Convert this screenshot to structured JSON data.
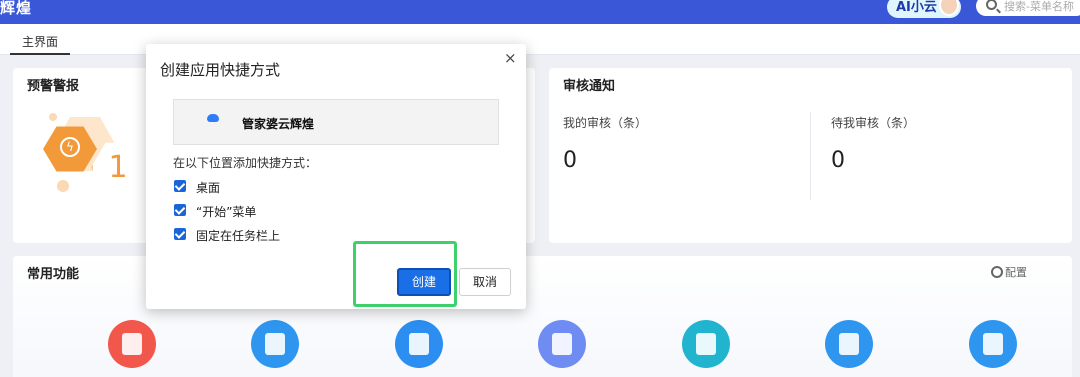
{
  "header": {
    "brand": "辉煌",
    "ai_label": "AI小云",
    "search_placeholder": "搜索-菜单名称"
  },
  "tabs": [
    {
      "label": "主界面"
    }
  ],
  "warning": {
    "title": "预警警报",
    "count": "1"
  },
  "audit": {
    "title": "审核通知",
    "mine_label": "我的审核（条）",
    "mine_value": "0",
    "pending_label": "待我审核（条）",
    "pending_value": "0"
  },
  "functions": {
    "title": "常用功能",
    "config_label": "配置",
    "icons": [
      "shopping-bag-icon",
      "document-icon",
      "chart-icon",
      "arrow-in-icon",
      "inbox-icon",
      "document-icon",
      "document-icon"
    ]
  },
  "dialog": {
    "title": "创建应用快捷方式",
    "close_glyph": "×",
    "app_name": "管家婆云辉煌",
    "subtitle": "在以下位置添加快捷方式：",
    "options": [
      {
        "label": "桌面",
        "checked": true
      },
      {
        "label": "“开始”菜单",
        "checked": true
      },
      {
        "label": "固定在任务栏上",
        "checked": true
      }
    ],
    "create_label": "创建",
    "cancel_label": "取消"
  },
  "colors": {
    "topbar": "#3a57d8",
    "accent": "#1a6fe6",
    "warning": "#f29a3a",
    "highlight": "#3ed16b"
  }
}
